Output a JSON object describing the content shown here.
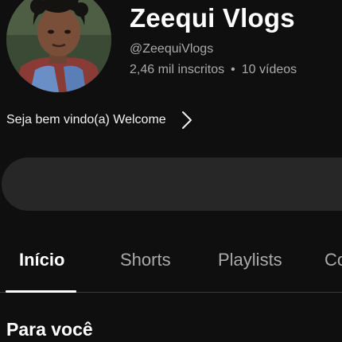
{
  "channel": {
    "name": "Zeequi Vlogs",
    "handle": "@ZeequiVlogs",
    "subscribers": "2,46 mil inscritos",
    "separator": "•",
    "videos": "10 vídeos"
  },
  "description": {
    "text": "Seja bem vindo(a) Welcome",
    "icon": "chevron-right-icon"
  },
  "tabs": [
    {
      "label": "Início",
      "active": true
    },
    {
      "label": "Shorts",
      "active": false
    },
    {
      "label": "Playlists",
      "active": false
    },
    {
      "label": "Co",
      "active": false
    }
  ],
  "section": {
    "title": "Para você"
  },
  "colors": {
    "background": "#0f0f0f",
    "primary_text": "#f1f1f1",
    "secondary_text": "#aaaaaa",
    "pill": "#272727",
    "divider": "#3a3a3a"
  }
}
